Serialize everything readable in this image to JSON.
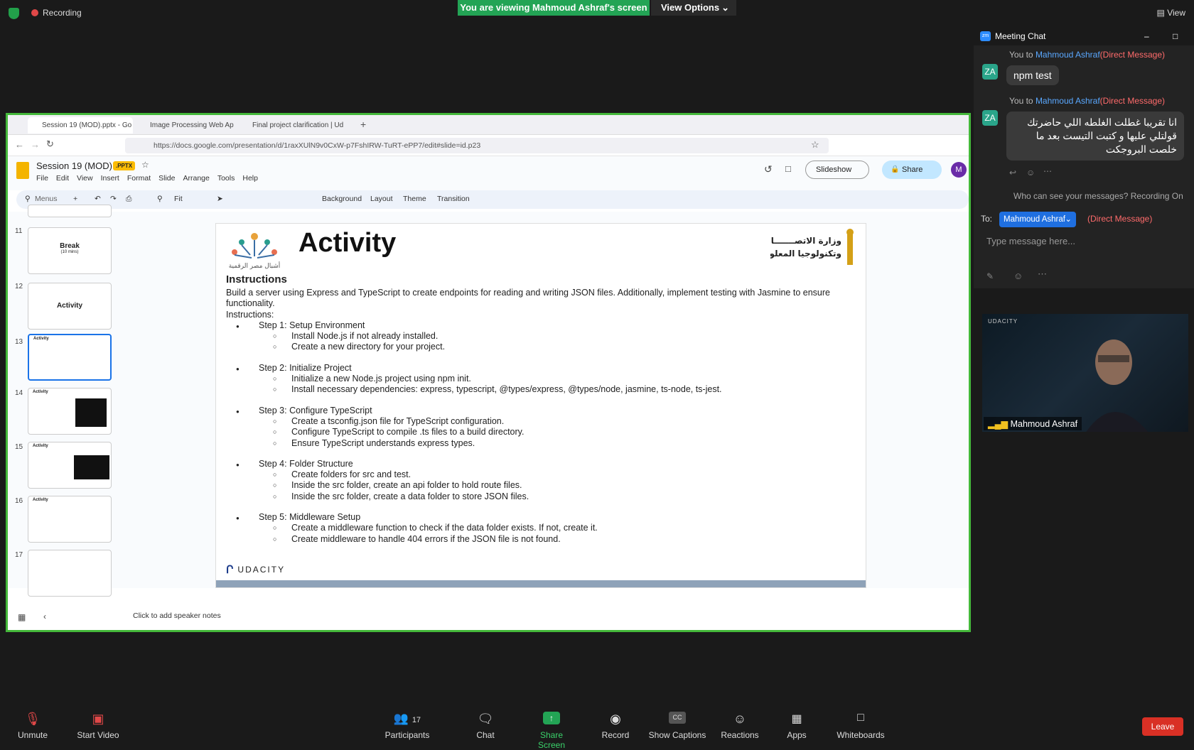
{
  "topbar": {
    "recording": "Recording",
    "viewing_banner": "You are viewing Mahmoud Ashraf's screen",
    "view_options": "View Options",
    "view": "View"
  },
  "browser": {
    "tabs": [
      "Session 19 (MOD).pptx - Go",
      "Image Processing Web Ap",
      "Final project clarification | Ud"
    ],
    "url": "https://docs.google.com/presentation/d/1raxXUlN9v0CxW-p7FshIRW-TuRT-ePP7/edit#slide=id.p23"
  },
  "slides_app": {
    "doc_title": "Session 19 (MOD)",
    "badge": ".PPTX",
    "menus": [
      "File",
      "Edit",
      "View",
      "Insert",
      "Format",
      "Slide",
      "Arrange",
      "Tools",
      "Help"
    ],
    "slideshow": "Slideshow",
    "share": "Share",
    "avatar": "M",
    "toolbar": {
      "menus_search": "Menus",
      "zoom": "Fit",
      "background": "Background",
      "layout": "Layout",
      "theme": "Theme",
      "transition": "Transition"
    },
    "thumbnails": [
      {
        "num": "11",
        "label": "Break",
        "sub": "(10 mins)"
      },
      {
        "num": "12",
        "label": "Activity",
        "sub": ""
      },
      {
        "num": "13",
        "label": "Activity",
        "sub": ""
      },
      {
        "num": "14",
        "label": "Activity",
        "sub": ""
      },
      {
        "num": "15",
        "label": "Activity",
        "sub": ""
      },
      {
        "num": "16",
        "label": "Activity",
        "sub": ""
      },
      {
        "num": "17",
        "label": "",
        "sub": ""
      }
    ],
    "speaker_notes": "Click to add speaker notes"
  },
  "slide": {
    "title": "Activity",
    "logo_left_text": "أشبال مصر الرقمية",
    "logo_right_line1": "وزارة الاتصـــــــالات",
    "logo_right_line2": "وتكنولوجيا المعلومات",
    "heading": "Instructions",
    "intro": "Build a server using Express and TypeScript to create endpoints for reading and writing JSON files. Additionally, implement testing with Jasmine to ensure functionality.",
    "instructions_label": "Instructions:",
    "steps": [
      {
        "title": "Step 1: Setup Environment",
        "items": [
          "Install Node.js if not already installed.",
          "Create a new directory for your project."
        ]
      },
      {
        "title": "Step 2: Initialize Project",
        "items": [
          "Initialize a new Node.js project using npm init.",
          "Install necessary dependencies: express, typescript, @types/express, @types/node, jasmine, ts-node, ts-jest."
        ]
      },
      {
        "title": "Step 3: Configure TypeScript",
        "items": [
          "Create a tsconfig.json file for TypeScript configuration.",
          "Configure TypeScript to compile .ts files to a build directory.",
          "Ensure TypeScript understands express types."
        ]
      },
      {
        "title": "Step 4: Folder Structure",
        "items": [
          "Create folders for src and test.",
          "Inside the src folder, create an api folder to hold route files.",
          "Inside the src folder, create a data folder to store JSON files."
        ]
      },
      {
        "title": "Step 5: Middleware Setup",
        "items": [
          "Create a middleware function to check if the data folder exists. If not, create it.",
          "Create middleware to handle 404 errors if the JSON file is not found."
        ]
      }
    ],
    "footer_brand": "UDACITY"
  },
  "chat": {
    "title": "Meeting Chat",
    "messages": [
      {
        "avatar": "ZA",
        "from": "You to ",
        "to": "Mahmoud Ashraf",
        "dm": "(Direct Message)",
        "text": "npm test"
      },
      {
        "avatar": "ZA",
        "from": "You to ",
        "to": "Mahmoud Ashraf",
        "dm": "(Direct Message)",
        "text": "انا تقريبا غطلت الغلطه اللي حاضرتك قولتلي عليها و كتبت التيست بعد ما خلصت البروجكت"
      }
    ],
    "who_can_see": "Who can see your messages? Recording On",
    "to_label": "To:",
    "to_recipient": "Mahmoud Ashraf",
    "to_dm": "(Direct Message)",
    "placeholder": "Type message here..."
  },
  "video": {
    "brand": "UDACITY",
    "name": "Mahmoud Ashraf"
  },
  "bottombar": {
    "unmute": "Unmute",
    "start_video": "Start Video",
    "participants": "Participants",
    "participants_count": "17",
    "chat": "Chat",
    "share_screen": "Share Screen",
    "record": "Record",
    "show_captions": "Show Captions",
    "reactions": "Reactions",
    "apps": "Apps",
    "whiteboards": "Whiteboards",
    "leave": "Leave"
  }
}
